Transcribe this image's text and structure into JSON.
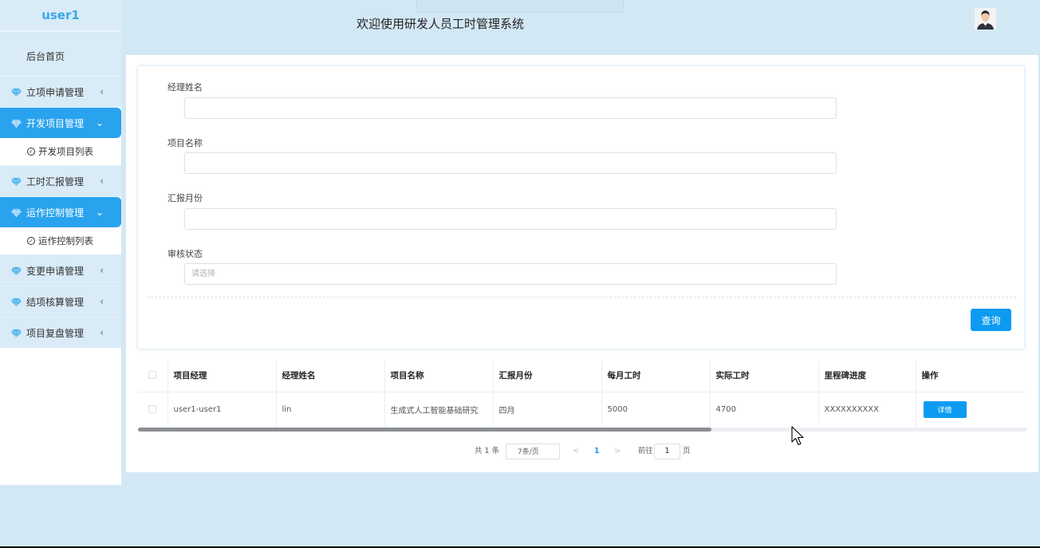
{
  "sidebar": {
    "brand": "user1",
    "home": "后台首页",
    "menus": [
      {
        "label": "立项申请管理",
        "expanded": false
      },
      {
        "label": "开发项目管理",
        "expanded": true,
        "sub": "开发项目列表"
      },
      {
        "label": "工时汇报管理",
        "expanded": false
      },
      {
        "label": "运作控制管理",
        "expanded": true,
        "sub": "运作控制列表"
      },
      {
        "label": "变更申请管理",
        "expanded": false
      },
      {
        "label": "结项核算管理",
        "expanded": false
      },
      {
        "label": "项目复盘管理",
        "expanded": false
      }
    ],
    "icon": "gem-icon",
    "accent_color": "#2aa3ee"
  },
  "header": {
    "title": "欢迎使用研发人员工时管理系统",
    "avatar_icon": "user-avatar"
  },
  "search": {
    "fields": [
      {
        "label": "经理姓名",
        "value": "",
        "placeholder": ""
      },
      {
        "label": "项目名称",
        "value": "",
        "placeholder": ""
      },
      {
        "label": "汇报月份",
        "value": "",
        "placeholder": ""
      },
      {
        "label": "审核状态",
        "value": "",
        "placeholder": "请选择"
      }
    ],
    "query_label": "查询"
  },
  "table": {
    "columns": [
      "项目经理",
      "经理姓名",
      "项目名称",
      "汇报月份",
      "每月工时",
      "实际工时",
      "里程碑进度",
      "操作"
    ],
    "rows": [
      {
        "manager": "user1-user1",
        "manager_name": "lin",
        "project_name": "生成式人工智能基础研究",
        "report_month": "四月",
        "monthly_hours": "5000",
        "actual_hours": "4700",
        "milestone": "XXXXXXXXXX",
        "action": "详情"
      }
    ],
    "scroll_fraction": 0.645
  },
  "pagination": {
    "total": "共 1 条",
    "page_size": "7条/页",
    "current_page": "1",
    "goto_label": "前往",
    "goto_value": "1",
    "page_unit": "页"
  },
  "colors": {
    "primary": "#0d9bf2",
    "background": "#d3e8f5"
  }
}
